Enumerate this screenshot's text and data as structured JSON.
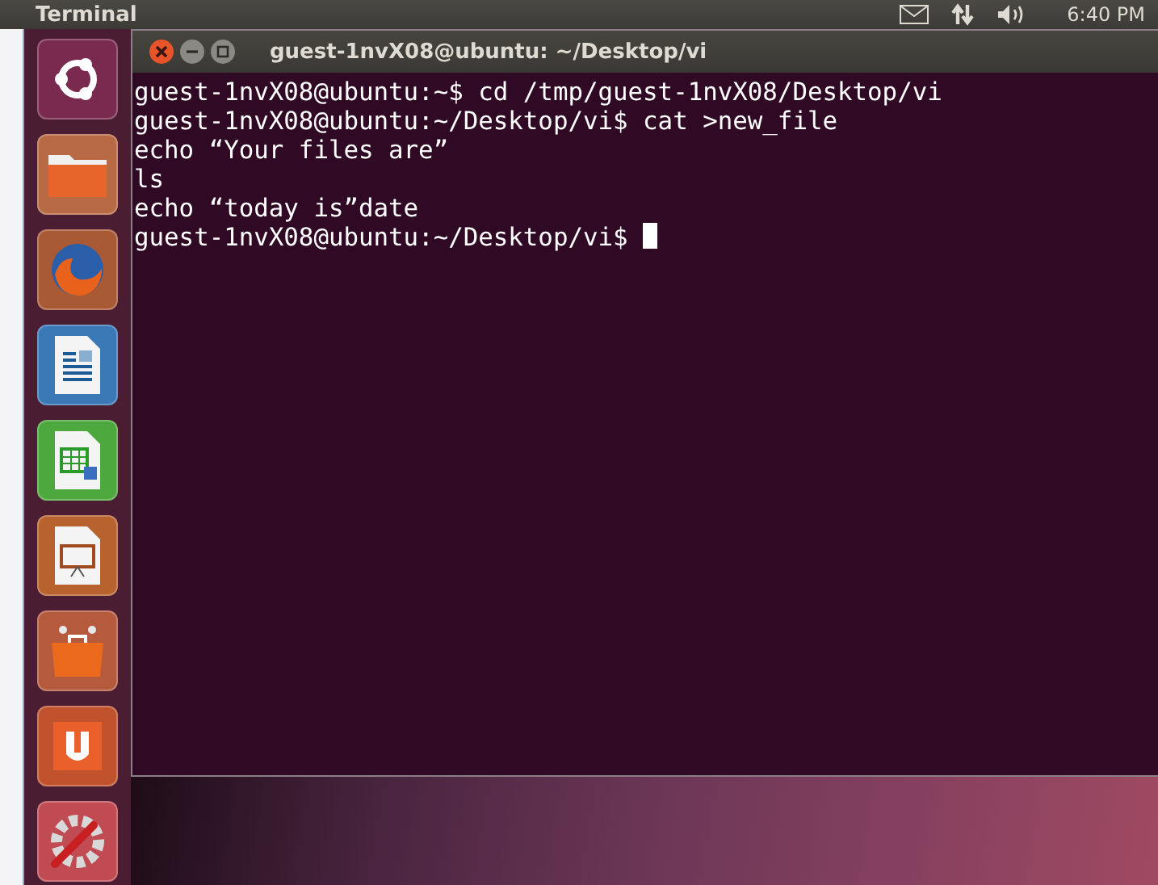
{
  "top_panel": {
    "app_title": "Terminal",
    "clock": "6:40 PM"
  },
  "terminal": {
    "title": "guest-1nvX08@ubuntu: ~/Desktop/vi",
    "lines": [
      "guest-1nvX08@ubuntu:~$ cd /tmp/guest-1nvX08/Desktop/vi",
      "guest-1nvX08@ubuntu:~/Desktop/vi$ cat >new_file",
      "echo “Your files are”",
      "ls",
      "echo “today is”date",
      "guest-1nvX08@ubuntu:~/Desktop/vi$ "
    ]
  }
}
